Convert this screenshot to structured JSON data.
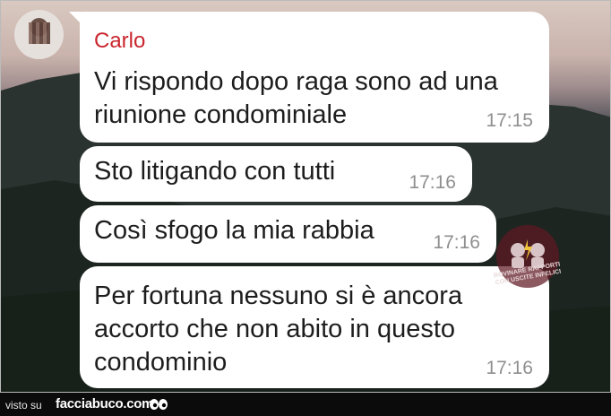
{
  "chat": {
    "sender_name": "Carlo",
    "messages": [
      {
        "text": "Vi rispondo dopo raga sono ad una riunione condominiale",
        "time": "17:15"
      },
      {
        "text": "Sto litigando con tutti",
        "time": "17:16"
      },
      {
        "text": "Così sfogo la mia rabbia",
        "time": "17:16"
      },
      {
        "text": "Per fortuna nessuno si è ancora accorto che non abito in questo condominio",
        "time": "17:16"
      }
    ]
  },
  "watermark": {
    "text": "ROVINARE RAPPORTI CON USCITE INFELICI"
  },
  "footer": {
    "visto_label": "visto su",
    "site": "facciabuco.com"
  },
  "colors": {
    "sender": "#c9252c",
    "bubble": "#ffffff",
    "time": "#8f8f8f",
    "footer_bg": "#0b0b0b"
  }
}
